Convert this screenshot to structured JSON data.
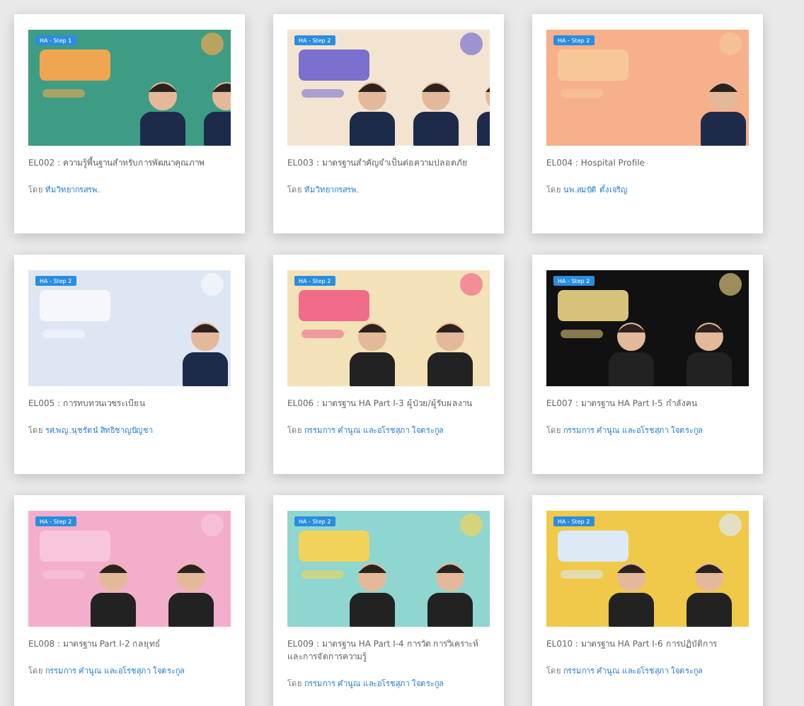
{
  "courses": [
    {
      "badge": "HA - Step 1",
      "title": "EL002 : ความรู้พื้นฐานสำหรับการพัฒนาคุณภาพ",
      "by": "โดย",
      "author": "ทีมวิทยากรสรพ."
    },
    {
      "badge": "HA - Step 2",
      "title": "EL003 : มาตรฐานสำคัญจำเป็นต่อความปลอดภัย",
      "by": "โดย",
      "author": "ทีมวิทยากรสรพ."
    },
    {
      "badge": "HA - Step 2",
      "title": "EL004 : Hospital Profile",
      "by": "โดย",
      "author": "นพ.สมบัติ ตั้งเจริญ"
    },
    {
      "badge": "HA - Step 2",
      "title": "EL005 : การทบทวนเวชระเบียน",
      "by": "โดย",
      "author": "รศ.พญ.นุชรัตน์ สิทธิชาญบัญชา"
    },
    {
      "badge": "HA - Step 2",
      "title": "EL006 : มาตรฐาน HA Part I-3 ผู้ป่วย/ผู้รับผลงาน",
      "by": "โดย",
      "author": "กรรมการ คำนูณ และอโรชสุภา ใจตระกูล"
    },
    {
      "badge": "HA - Step 2",
      "title": "EL007 : มาตรฐาน HA Part I-5 กำลังคน",
      "by": "โดย",
      "author": "กรรมการ คำนูณ และอโรชสุภา ใจตระกูล"
    },
    {
      "badge": "HA - Step 2",
      "title": "EL008 : มาตรฐาน Part I-2 กลยุทธ์",
      "by": "โดย",
      "author": "กรรมการ คำนูณ และอโรชสุภา ใจตระกูล"
    },
    {
      "badge": "HA - Step 2",
      "title": "EL009 : มาตรฐาน HA Part I-4 การวัด การวิเคราะห์ และการจัดการความรู้",
      "by": "โดย",
      "author": "กรรมการ คำนูณ และอโรชสุภา ใจตระกูล"
    },
    {
      "badge": "HA - Step 2",
      "title": "EL010 : มาตรฐาน HA Part I-6 การปฏิบัติการ",
      "by": "โดย",
      "author": "กรรมการ คำนูณ และอโรชสุภา ใจตระกูล"
    }
  ]
}
